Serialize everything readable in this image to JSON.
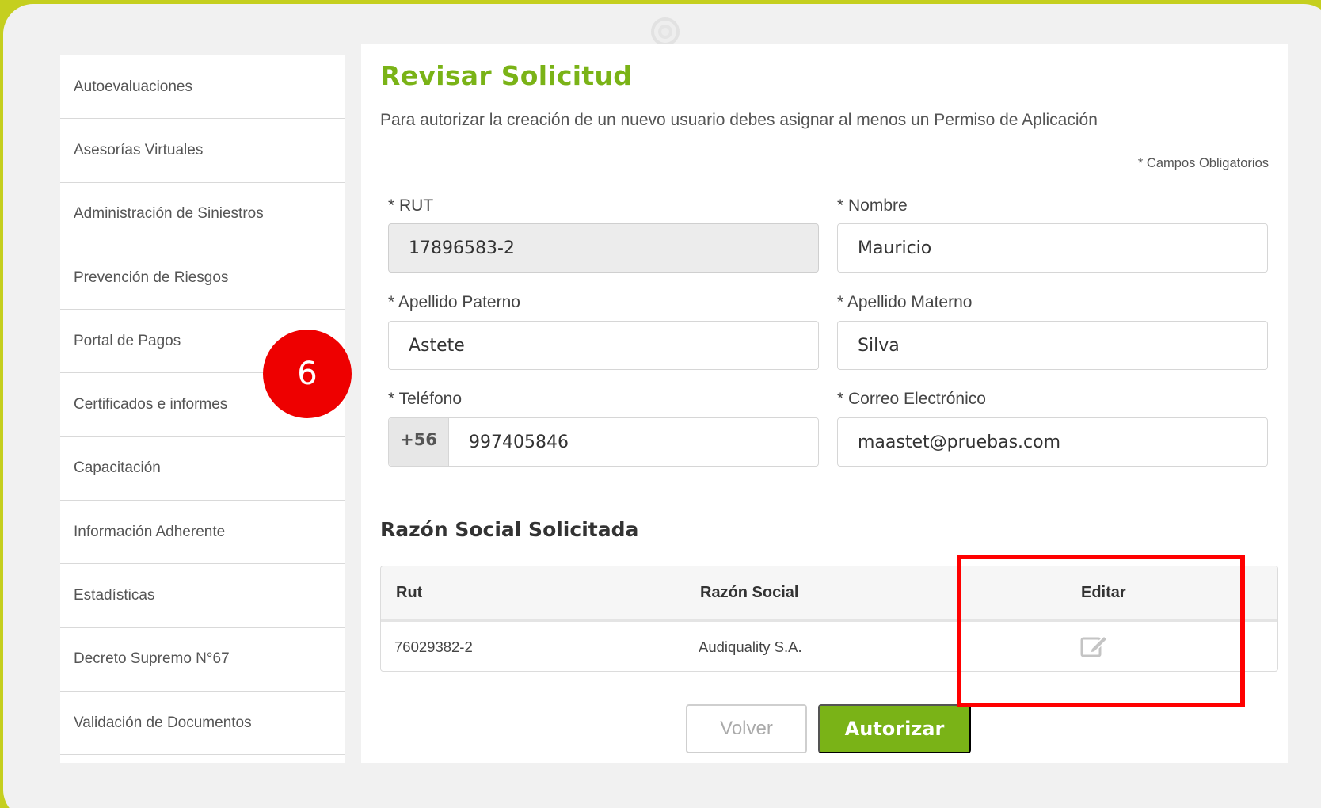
{
  "sidebar": {
    "items": [
      {
        "label": "Autoevaluaciones"
      },
      {
        "label": "Asesorías Virtuales"
      },
      {
        "label": "Administración de Siniestros"
      },
      {
        "label": "Prevención de Riesgos"
      },
      {
        "label": "Portal de Pagos"
      },
      {
        "label": "Certificados e informes"
      },
      {
        "label": "Capacitación"
      },
      {
        "label": "Información Adherente"
      },
      {
        "label": "Estadísticas"
      },
      {
        "label": "Decreto Supremo N°67"
      },
      {
        "label": "Validación de Documentos"
      }
    ]
  },
  "page": {
    "title": "Revisar Solicitud",
    "subtitle": "Para autorizar la creación de un nuevo usuario debes asignar al menos un Permiso de Aplicación",
    "required_note": "* Campos Obligatorios"
  },
  "form": {
    "rut": {
      "label": "* RUT",
      "value": "17896583-2"
    },
    "nombre": {
      "label": "* Nombre",
      "value": "Mauricio"
    },
    "apellido_paterno": {
      "label": "* Apellido Paterno",
      "value": "Astete"
    },
    "apellido_materno": {
      "label": "* Apellido Materno",
      "value": "Silva"
    },
    "telefono": {
      "label": "* Teléfono",
      "prefix": "+56",
      "value": "997405846"
    },
    "correo": {
      "label": "* Correo Electrónico",
      "value": "maastet@pruebas.com"
    }
  },
  "razon_social": {
    "title": "Razón Social Solicitada",
    "columns": [
      "Rut",
      "Razón Social",
      "Editar"
    ],
    "rows": [
      {
        "rut": "76029382-2",
        "razon_social": "Audiquality S.A.",
        "edit_icon": "edit-icon"
      }
    ]
  },
  "buttons": {
    "back": "Volver",
    "authorize": "Autorizar"
  },
  "annotation": {
    "step_number": "6",
    "color": "#ee0000"
  },
  "colors": {
    "brand_green": "#7ab317",
    "frame_yellow": "#c5cf1f"
  }
}
